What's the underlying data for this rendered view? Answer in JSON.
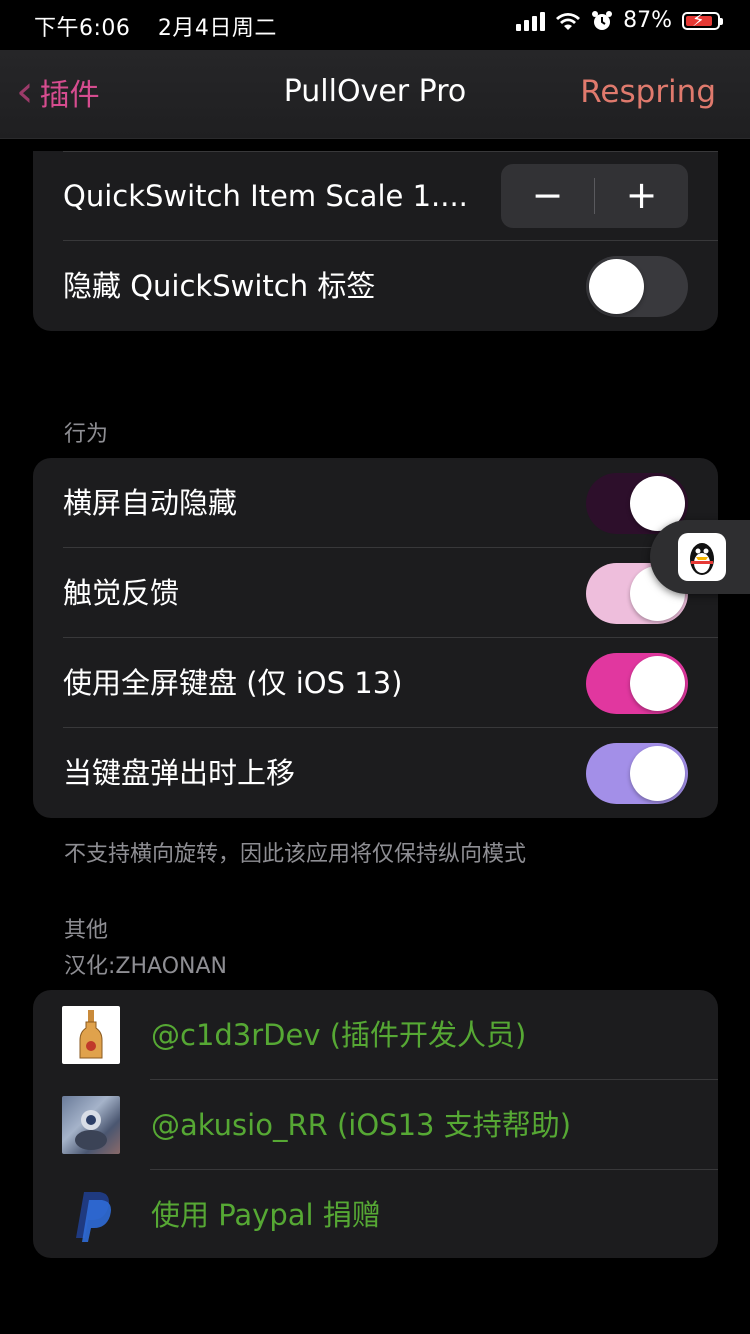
{
  "status_bar": {
    "time": "下午6:06",
    "date": "2月4日周二",
    "battery_percent": "87%"
  },
  "nav": {
    "back_label": "插件",
    "title": "PullOver Pro",
    "right_button": "Respring"
  },
  "top_group": {
    "rows": [
      {
        "label": "QuickSwitch Item Scale 1....",
        "control": "stepper",
        "minus": "−",
        "plus": "+"
      },
      {
        "label": "隐藏 QuickSwitch 标签",
        "control": "toggle",
        "on": false,
        "color": "#39393d"
      }
    ]
  },
  "behavior": {
    "header": "行为",
    "rows": [
      {
        "label": "横屏自动隐藏",
        "on": true,
        "color": "#2d0f2b"
      },
      {
        "label": "触觉反馈",
        "on": true,
        "color": "#eebedc"
      },
      {
        "label": "使用全屏键盘 (仅 iOS 13)",
        "on": true,
        "color": "#e1379f"
      },
      {
        "label": "当键盘弹出时上移",
        "on": true,
        "color": "#a38fe8"
      }
    ],
    "footer": "不支持横向旋转，因此该应用将仅保持纵向模式"
  },
  "other": {
    "header": "其他",
    "subheader": "汉化:ZHAONAN",
    "rows": [
      {
        "label": "@c1d3rDev (插件开发人员)",
        "icon": "bottle-icon"
      },
      {
        "label": "@akusio_RR (iOS13 支持帮助)",
        "icon": "avatar-photo"
      },
      {
        "label": "使用 Paypal 捐赠",
        "icon": "paypal-icon"
      }
    ],
    "link_color": "#56a834"
  },
  "accent": {
    "back": "#d64c8f",
    "respring": "#e07a6d"
  }
}
